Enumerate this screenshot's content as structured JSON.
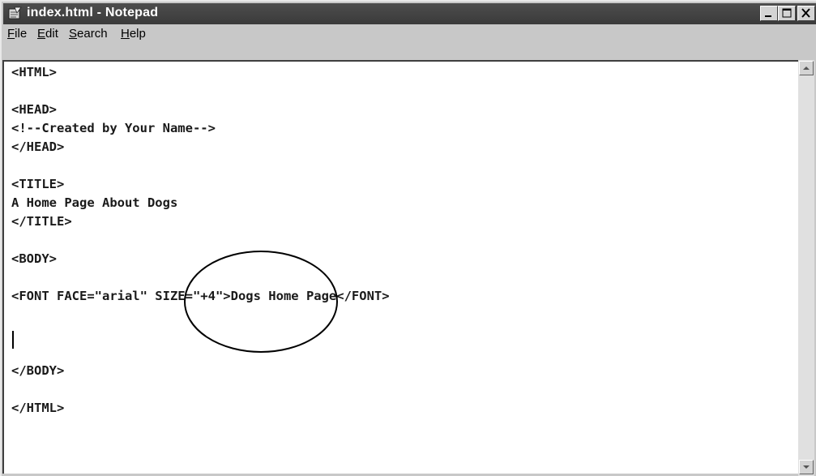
{
  "window": {
    "title": "index.html - Notepad",
    "controls": [
      "minimize",
      "maximize",
      "close"
    ]
  },
  "menu": {
    "file": {
      "accel": "F",
      "rest": "ile"
    },
    "edit": {
      "accel": "E",
      "rest": "dit"
    },
    "search": {
      "accel": "S",
      "rest": "earch"
    },
    "help": {
      "accel": "H",
      "rest": "elp"
    }
  },
  "editor": {
    "lines": [
      "<HTML>",
      "",
      "<HEAD>",
      "<!--Created by Your Name-->",
      "</HEAD>",
      "",
      "<TITLE>",
      "A Home Page About Dogs",
      "</TITLE>",
      "",
      "<BODY>",
      "",
      "<FONT FACE=\"arial\" SIZE=\"+4\">Dogs Home Page</FONT>",
      "",
      "",
      "",
      "</BODY>",
      "",
      "</HTML>"
    ]
  },
  "icons": {
    "app": "notepad-icon",
    "minimize": "minimize-icon",
    "maximize": "maximize-icon",
    "close": "close-icon",
    "scroll_up": "arrow-up-icon",
    "scroll_down": "arrow-down-icon"
  },
  "colors": {
    "titlebar": "#3f3f3f",
    "chrome": "#c8c8c8",
    "editor_bg": "#ffffff",
    "text": "#1a1a1a",
    "highlight_circle": "#000000"
  }
}
